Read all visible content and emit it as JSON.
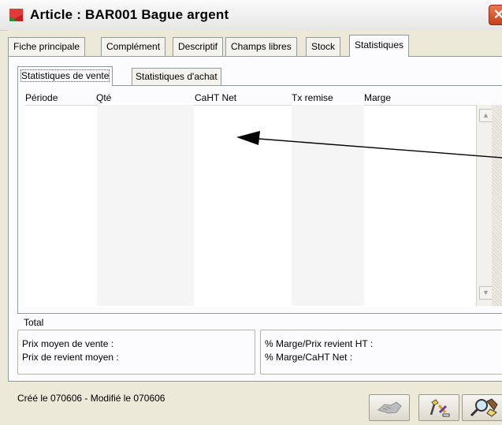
{
  "window": {
    "title": "Article : BAR001 Bague argent",
    "close_glyph": "✕"
  },
  "tabs": [
    {
      "label": "Fiche principale"
    },
    {
      "label": "Complément"
    },
    {
      "label": "Descriptif"
    },
    {
      "label": "Champs libres"
    },
    {
      "label": "Stock"
    },
    {
      "label": "Statistiques",
      "active": true
    }
  ],
  "subtabs": [
    {
      "label": "Statistiques de vente",
      "active": true
    },
    {
      "label": "Statistiques d'achat"
    }
  ],
  "grid": {
    "columns": [
      "Période",
      "Qté",
      "CaHT Net",
      "Tx remise",
      "Marge"
    ],
    "rows": []
  },
  "summary": {
    "total_label": "Total",
    "prix_moyen_vente": "Prix moyen de vente :",
    "prix_revient_moyen": "Prix de revient moyen :",
    "marge_prix_revient": "% Marge/Prix revient HT :",
    "marge_caht": "% Marge/CaHT Net :"
  },
  "status": {
    "text": "Créé le 070606 - Modifié le 070606"
  },
  "toolbar": [
    {
      "icon": "handshake-icon",
      "enabled": false
    },
    {
      "icon": "tools-icon",
      "enabled": true
    },
    {
      "icon": "search-icon",
      "enabled": true
    }
  ],
  "colors": {
    "window_bg": "#ece9d8",
    "panel_bg": "#fcfcfe",
    "close_button": "#d5532b",
    "arrow": "#000000"
  }
}
